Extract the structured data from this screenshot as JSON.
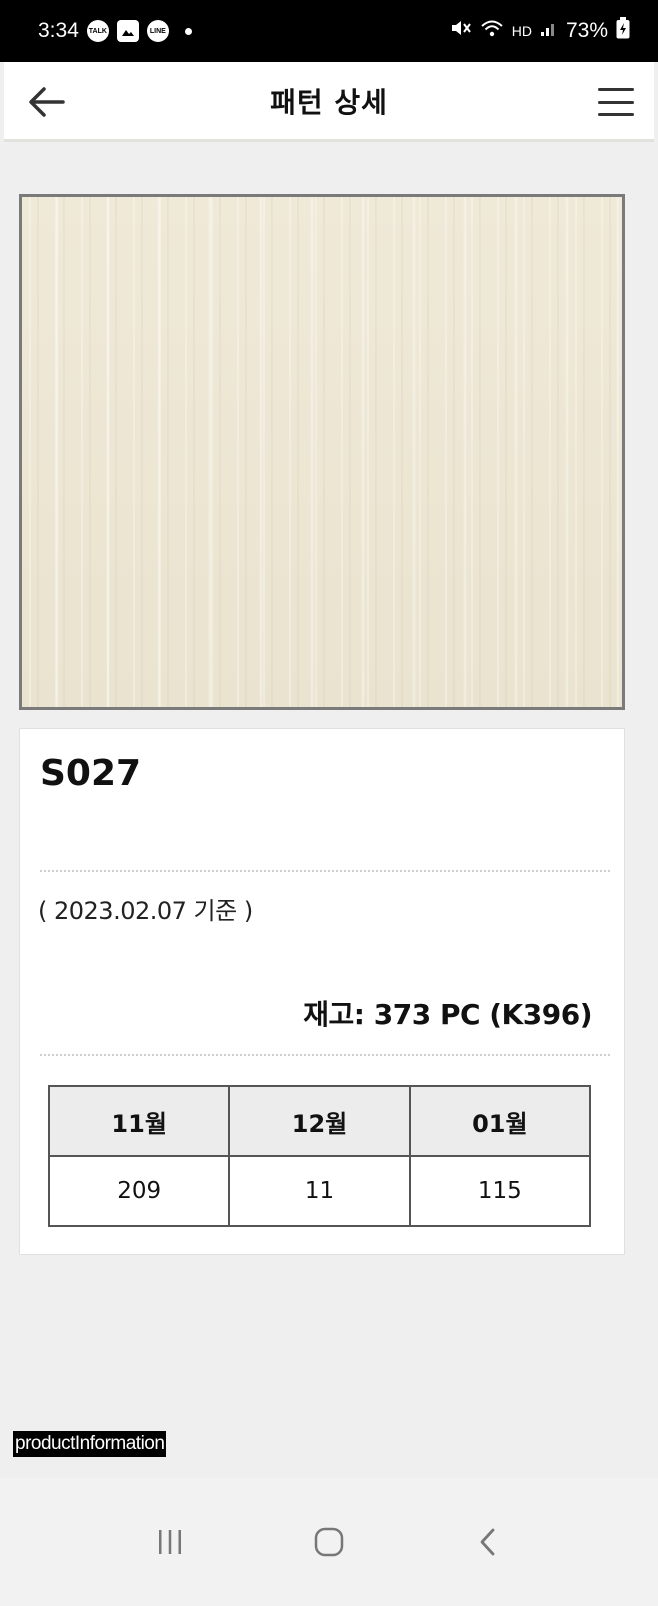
{
  "status_bar": {
    "time": "3:34",
    "notif_icons": [
      "talk-icon",
      "gallery-icon",
      "line-icon"
    ],
    "battery": "73%"
  },
  "header": {
    "title": "패턴 상세",
    "back_icon": "back-arrow-icon",
    "menu_icon": "hamburger-menu-icon"
  },
  "product": {
    "code": "S027",
    "as_of": "( 2023.02.07 기준 )",
    "stock": "재고: 373 PC (K396)",
    "image_color": "#ede7d5"
  },
  "monthly_table": {
    "headers": [
      "11월",
      "12월",
      "01월"
    ],
    "values": [
      "209",
      "11",
      "115"
    ]
  },
  "debug_label": "productInformation",
  "nav": {
    "recents_icon": "recents-icon",
    "home_icon": "home-icon",
    "back_icon": "back-chevron-icon"
  }
}
